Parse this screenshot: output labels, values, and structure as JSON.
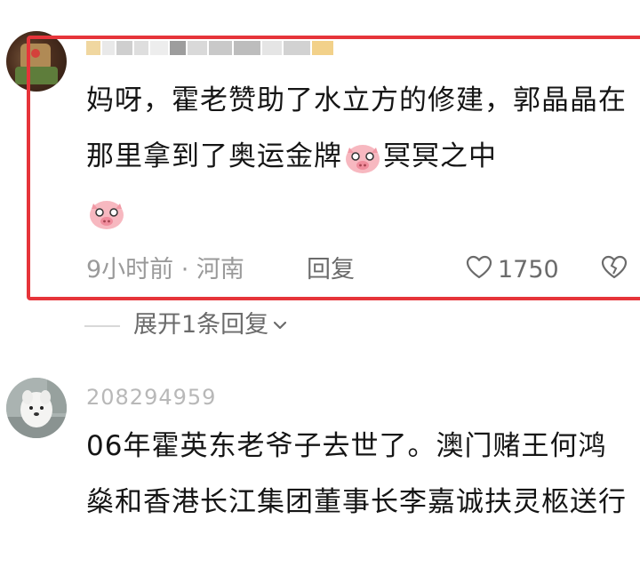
{
  "comment1": {
    "text_part1": "妈呀，霍老赞助了水立方的修建，郭晶晶在那里拿到了奥运金牌",
    "text_part2": "冥冥之中",
    "emoji": "pig-emoji",
    "time": "9小时前 · 河南",
    "reply_label": "回复",
    "like_count": "1750",
    "expand_label": "展开1条回复"
  },
  "comment2": {
    "username": "208294959",
    "text": "06年霍英东老爷子去世了。澳门赌王何鸿燊和香港长江集团董事长李嘉诚扶灵柩送行"
  },
  "colors": {
    "highlight_frame": "#e6343a",
    "meta_text": "#9a9a9a"
  },
  "icons": [
    "heart-outline-icon",
    "broken-heart-icon",
    "chevron-down-icon",
    "pig-emoji"
  ]
}
